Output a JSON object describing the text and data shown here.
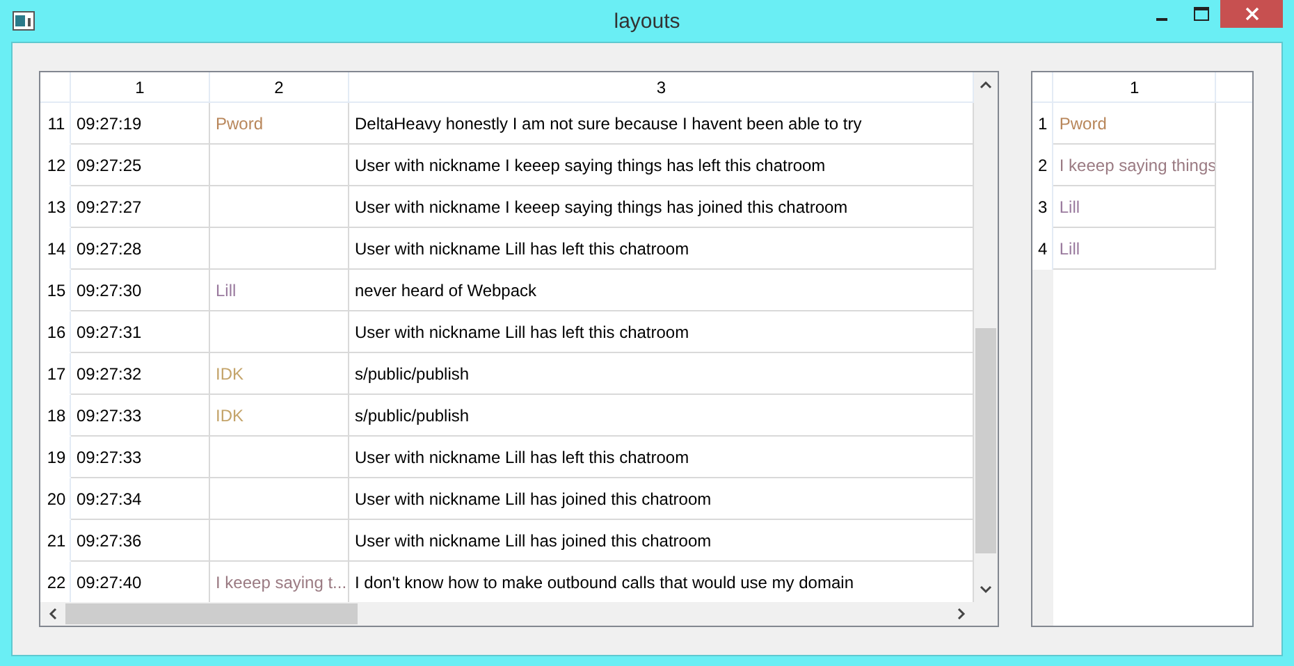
{
  "window": {
    "title": "layouts"
  },
  "table": {
    "columns": [
      "1",
      "2",
      "3"
    ],
    "rows": [
      {
        "number": "11",
        "time": "09:27:19",
        "nickname": "Pword",
        "color": "#b8865a",
        "message": "DeltaHeavy honestly I am not sure because I havent been able to try"
      },
      {
        "number": "12",
        "time": "09:27:25",
        "message": "User with nickname I keeep saying things has left this chatroom"
      },
      {
        "number": "13",
        "time": "09:27:27",
        "message": "User with nickname I keeep saying things has joined this chatroom"
      },
      {
        "number": "14",
        "time": "09:27:28",
        "message": "User with nickname Lill has left this chatroom"
      },
      {
        "number": "15",
        "time": "09:27:30",
        "nickname": "Lill",
        "color": "#9a7a9e",
        "message": "never heard of Webpack"
      },
      {
        "number": "16",
        "time": "09:27:31",
        "message": "User with nickname Lill has left this chatroom"
      },
      {
        "number": "17",
        "time": "09:27:32",
        "nickname": "IDK",
        "color": "#c4a46a",
        "message": "s/public/publish"
      },
      {
        "number": "18",
        "time": "09:27:33",
        "nickname": "IDK",
        "color": "#c4a46a",
        "message": "s/public/publish"
      },
      {
        "number": "19",
        "time": "09:27:33",
        "message": "User with nickname Lill has left this chatroom"
      },
      {
        "number": "20",
        "time": "09:27:34",
        "message": "User with nickname Lill has joined this chatroom"
      },
      {
        "number": "21",
        "time": "09:27:36",
        "message": "User with nickname Lill has joined this chatroom"
      },
      {
        "number": "22",
        "time": "09:27:40",
        "nickname": "I keeep saying t...",
        "color": "#9a7a82",
        "message": "I don't know how to make outbound calls that would use my domain"
      }
    ]
  },
  "side_table": {
    "columns": [
      "1"
    ],
    "rows": [
      {
        "number": "1",
        "nickname": "Pword",
        "color": "#b8865a"
      },
      {
        "number": "2",
        "nickname": "I keeep saying things",
        "color": "#9a7a82"
      },
      {
        "number": "3",
        "nickname": "Lill",
        "color": "#9a7a9e"
      },
      {
        "number": "4",
        "nickname": "Lill",
        "color": "#9a7a9e"
      }
    ]
  }
}
